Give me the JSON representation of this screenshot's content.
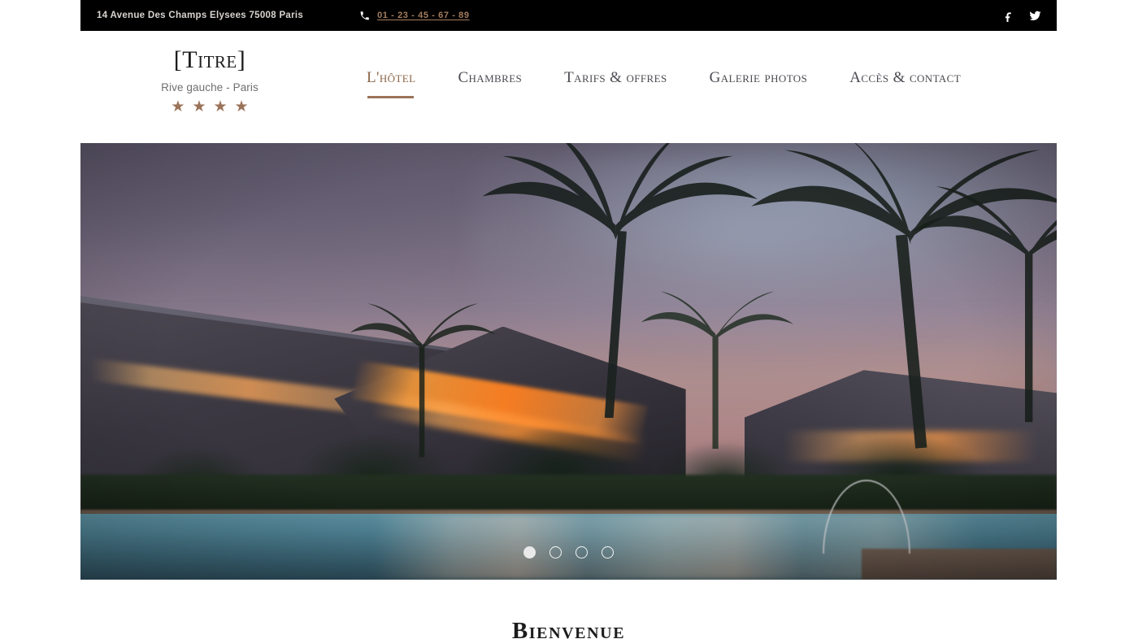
{
  "topbar": {
    "address": "14 Avenue Des Champs Elysees 75008 Paris",
    "phone_icon": "phone-icon",
    "phone": "01 - 23 - 45 - 67 - 89",
    "social": [
      {
        "name": "facebook-icon",
        "label": "Facebook"
      },
      {
        "name": "twitter-icon",
        "label": "Twitter"
      }
    ],
    "background_color": "#000000",
    "phone_link_color": "#a57d5e"
  },
  "brand": {
    "title": "[Titre]",
    "subtitle": "Rive gauche - Paris",
    "star_count": 4,
    "star_glyph": "★",
    "star_color": "#9a7359"
  },
  "nav": {
    "items": [
      {
        "label": "L'hôtel",
        "active": true
      },
      {
        "label": "Chambres",
        "active": false
      },
      {
        "label": "Tarifs & offres",
        "active": false
      },
      {
        "label": "Galerie photos",
        "active": false
      },
      {
        "label": "Accès & contact",
        "active": false
      }
    ],
    "active_color": "#8b6548",
    "inactive_color": "#4b4b52",
    "underline_color": "#9a7359"
  },
  "hero": {
    "alt": "Resort buildings with palm trees and swimming pool at dusk",
    "slide_count": 4,
    "active_slide": 1
  },
  "welcome": {
    "title": "Bienvenue"
  }
}
